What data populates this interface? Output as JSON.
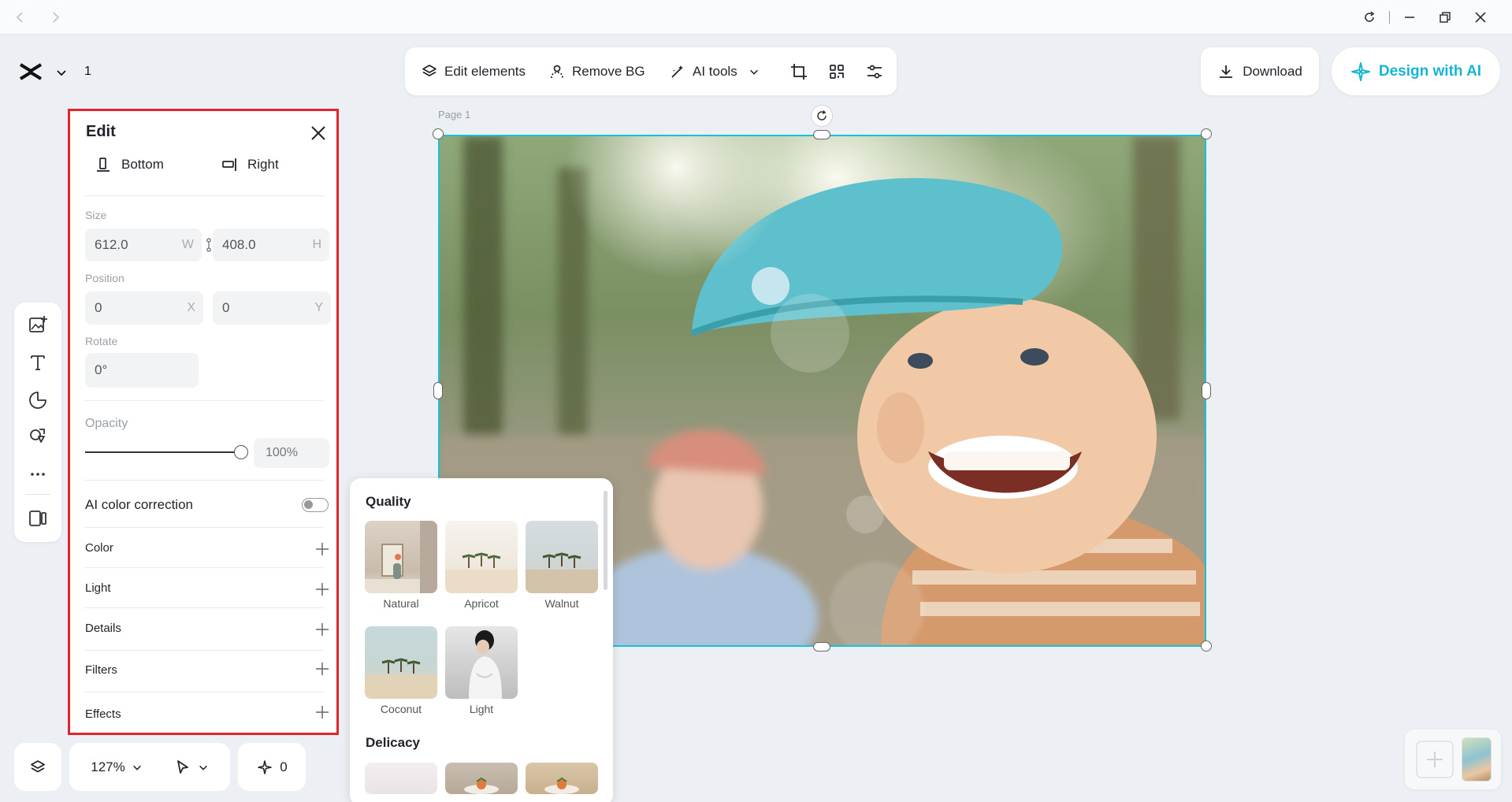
{
  "window": {
    "icons": [
      "back-icon",
      "forward-icon",
      "refresh-icon",
      "minimize-icon",
      "restore-icon",
      "close-icon"
    ]
  },
  "header": {
    "page_count": "1"
  },
  "toolbar": {
    "edit_elements": "Edit elements",
    "remove_bg": "Remove BG",
    "ai_tools": "AI tools",
    "download": "Download",
    "design_with_ai": "Design with AI",
    "accent": "#15b5d4"
  },
  "edit_panel": {
    "title": "Edit",
    "align_bottom": "Bottom",
    "align_right": "Right",
    "size_label": "Size",
    "width": "612.0",
    "width_suffix": "W",
    "height": "408.0",
    "height_suffix": "H",
    "position_label": "Position",
    "x": "0",
    "x_suffix": "X",
    "y": "0",
    "y_suffix": "Y",
    "rotate_label": "Rotate",
    "rotate": "0°",
    "opacity_label": "Opacity",
    "opacity_value": "100%",
    "opacity_level": 1.0,
    "ai_color_correction": "AI color correction",
    "ai_color_correction_on": false,
    "sections": [
      "Color",
      "Light",
      "Details",
      "Filters",
      "Effects"
    ],
    "highlight_color": "#e0252c"
  },
  "canvas": {
    "page_label": "Page 1",
    "selection_color": "#18c0dc"
  },
  "filters_popup": {
    "quality_heading": "Quality",
    "quality_items": [
      "Natural",
      "Apricot",
      "Walnut",
      "Coconut",
      "Light"
    ],
    "delicacy_heading": "Delicacy"
  },
  "bottom_bar": {
    "zoom": "127%",
    "ai_count": "0"
  }
}
